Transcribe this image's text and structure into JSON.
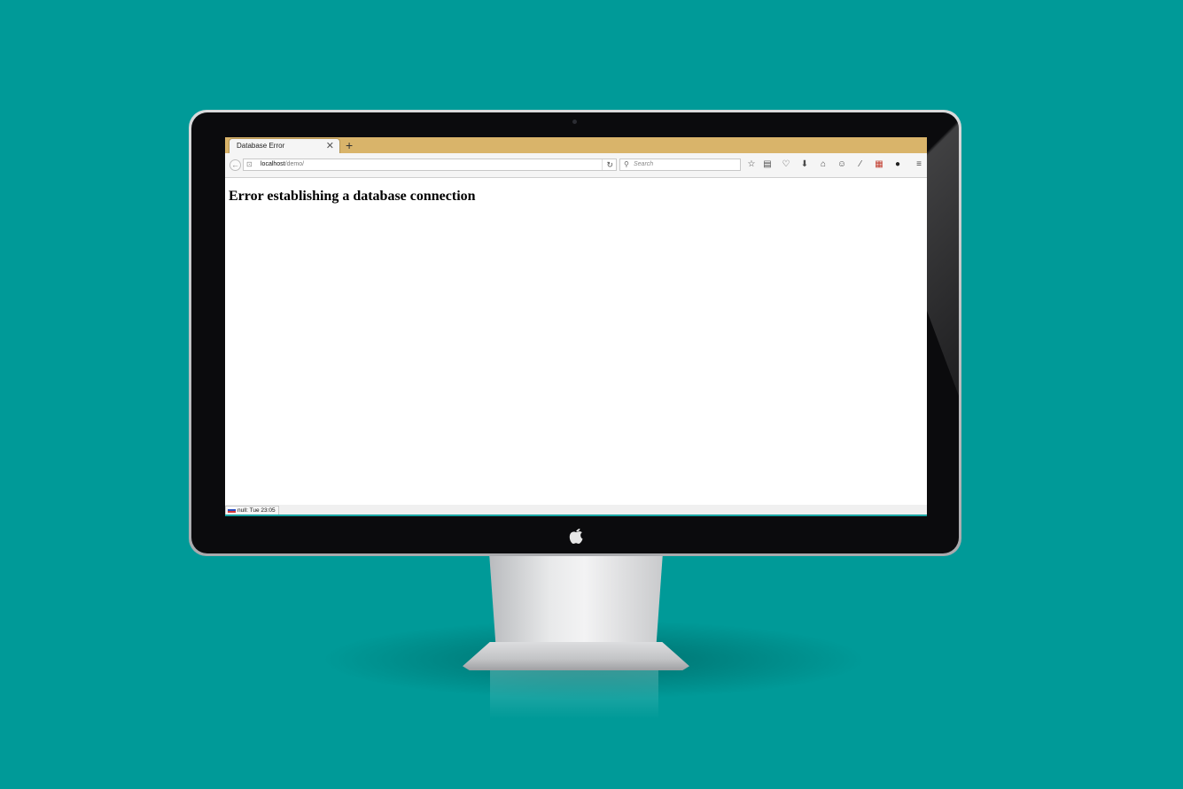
{
  "colors": {
    "background": "#009a98",
    "tab_bar": "#d9b46a",
    "bezel": "#0b0b0d"
  },
  "browser": {
    "tab": {
      "title": "Database Error",
      "close_icon": "close-icon"
    },
    "new_tab_label": "+",
    "url": {
      "host": "localhost",
      "path": "/demo/"
    },
    "search_placeholder": "Search",
    "toolbar_icons": [
      "bookmark-star-icon",
      "reading-list-icon",
      "pocket-icon",
      "download-icon",
      "home-icon",
      "chat-icon",
      "pen-icon",
      "extension-icon",
      "dark-extension-icon",
      "hamburger-menu-icon"
    ]
  },
  "page": {
    "heading": "Error establishing a database connection"
  },
  "status": {
    "text": "null: Tue 23:05"
  }
}
